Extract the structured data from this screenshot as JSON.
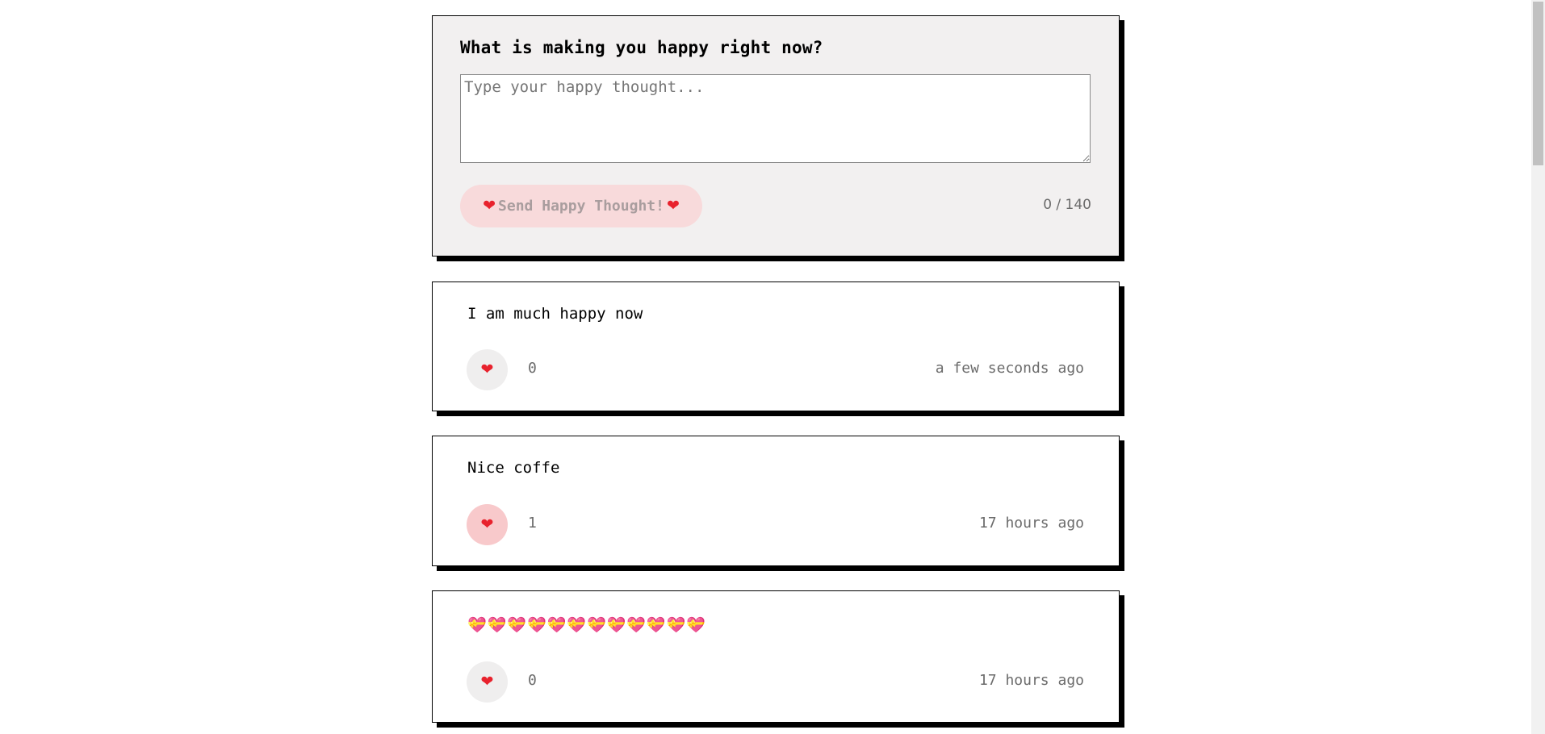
{
  "form": {
    "title": "What is making you happy right now?",
    "placeholder": "Type your happy thought...",
    "value": "",
    "send_label": "Send Happy Thought!",
    "char_count": "0 / 140"
  },
  "icons": {
    "heart": "heart-icon",
    "gift_heart": "gift-heart-icon"
  },
  "colors": {
    "heart_red": "#e8222d",
    "button_pink": "#f8dadb",
    "liked_pink": "#f8c9cb",
    "unliked_grey": "#efeeee"
  },
  "thoughts": [
    {
      "message": "I am much happy now",
      "hearts": "0",
      "time": "a few seconds ago",
      "liked": false
    },
    {
      "message": "Nice coffe",
      "hearts": "1",
      "time": "17 hours ago",
      "liked": true
    },
    {
      "message": "💝💝💝💝💝💝💝💝💝💝💝💝",
      "hearts": "0",
      "time": "17 hours ago",
      "liked": false
    }
  ]
}
